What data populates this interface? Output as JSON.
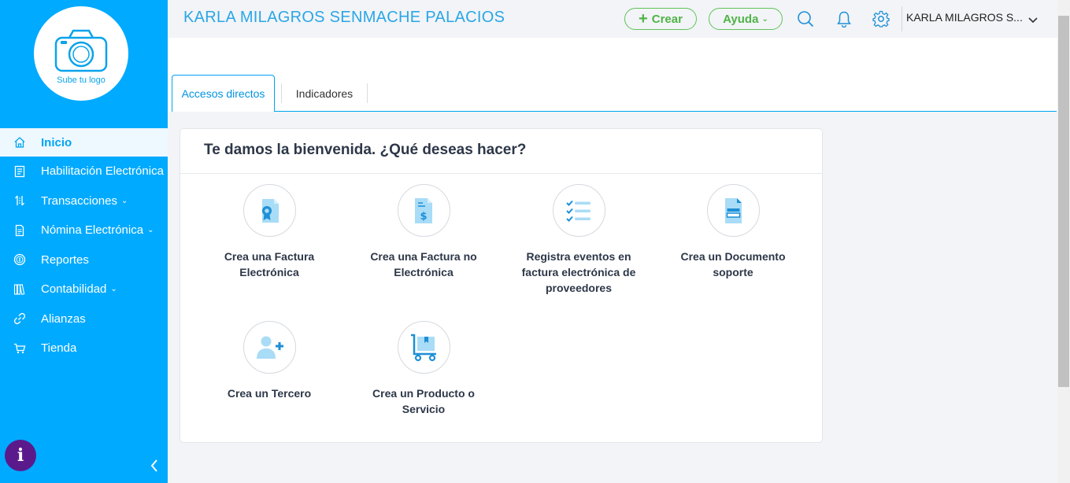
{
  "sidebar": {
    "logo_text": "Sube tu logo",
    "items": [
      {
        "label": "Inicio",
        "icon": "home-icon",
        "active": true
      },
      {
        "label": "Habilitación Electrónica",
        "icon": "register-icon"
      },
      {
        "label": "Transacciones",
        "icon": "transactions-icon",
        "has_submenu": true
      },
      {
        "label": "Nómina Electrónica",
        "icon": "payroll-icon",
        "has_submenu": true
      },
      {
        "label": "Reportes",
        "icon": "reports-icon"
      },
      {
        "label": "Contabilidad",
        "icon": "accounting-icon",
        "has_submenu": true
      },
      {
        "label": "Alianzas",
        "icon": "link-icon"
      },
      {
        "label": "Tienda",
        "icon": "cart-icon"
      }
    ],
    "info_label": "i"
  },
  "header": {
    "company": "KARLA MILAGROS SENMACHE PALACIOS",
    "crear_label": "Crear",
    "ayuda_label": "Ayuda",
    "user_name": "KARLA MILAGROS S..."
  },
  "tabs": [
    {
      "label": "Accesos directos",
      "active": true
    },
    {
      "label": "Indicadores"
    }
  ],
  "card": {
    "title": "Te damos la bienvenida. ¿Qué deseas hacer?",
    "actions": [
      {
        "label": "Crea una Factura Electrónica",
        "icon": "invoice-award-icon"
      },
      {
        "label": "Crea una Factura no Electrónica",
        "icon": "invoice-dollar-icon"
      },
      {
        "label": "Registra eventos en factura electrónica de proveedores",
        "icon": "checklist-icon"
      },
      {
        "label": "Crea un Documento soporte",
        "icon": "support-document-icon"
      },
      {
        "label": "Crea un Tercero",
        "icon": "add-user-icon"
      },
      {
        "label": "Crea un Producto o Servicio",
        "icon": "product-cart-icon"
      }
    ]
  },
  "colors": {
    "sidebar_bg": "#00aaff",
    "accent": "#00a4f2",
    "green": "#4fb346",
    "info_purple": "#5b1a8c",
    "icon_light": "#a9dcf6",
    "icon_dark": "#1d8fd6"
  }
}
